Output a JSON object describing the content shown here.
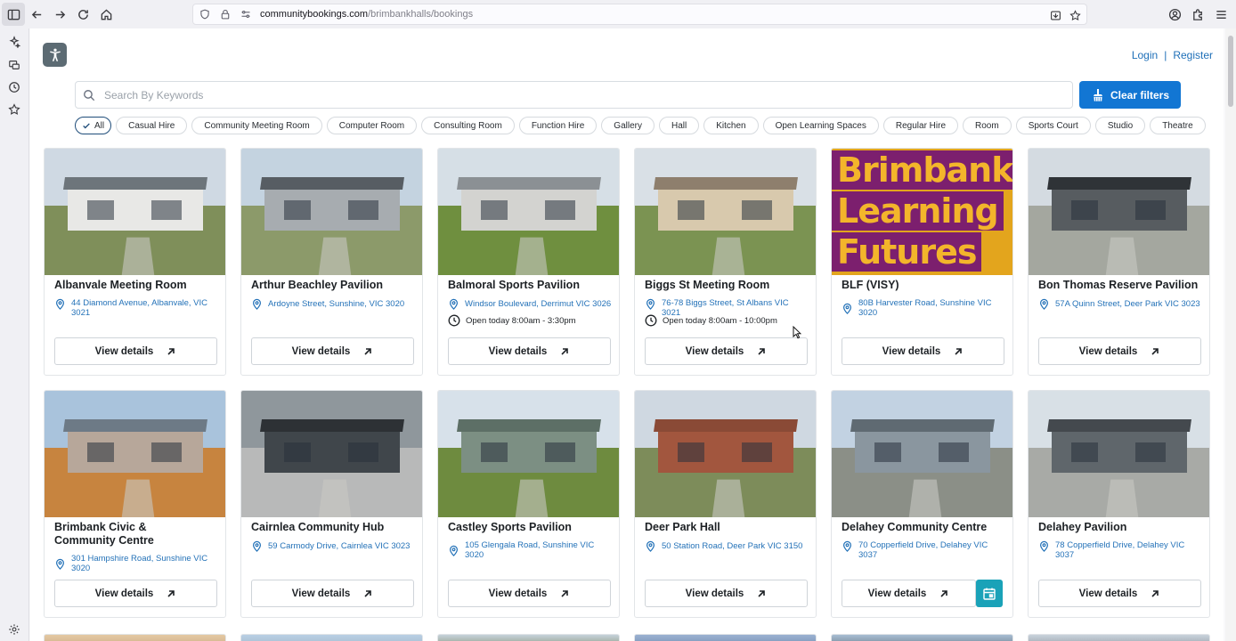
{
  "browser": {
    "url_host": "communitybookings.com",
    "url_path": "/brimbankhalls/bookings"
  },
  "header": {
    "login": "Login",
    "separator": "|",
    "register": "Register"
  },
  "search": {
    "placeholder": "Search By Keywords"
  },
  "clear_filters": "Clear filters",
  "filters": [
    "All",
    "Casual Hire",
    "Community Meeting Room",
    "Computer Room",
    "Consulting Room",
    "Function Hire",
    "Gallery",
    "Hall",
    "Kitchen",
    "Open Learning Spaces",
    "Regular Hire",
    "Room",
    "Sports Court",
    "Studio",
    "Theatre"
  ],
  "active_filter": "All",
  "view_details_label": "View details",
  "accent_color": "#1276d3",
  "calendar_color": "#1aa2b8",
  "venues": [
    {
      "name": "Albanvale Meeting Room",
      "address": "44 Diamond Avenue, Albanvale, VIC 3021",
      "hours": ""
    },
    {
      "name": "Arthur Beachley Pavilion",
      "address": "Ardoyne Street, Sunshine, VIC 3020",
      "hours": ""
    },
    {
      "name": "Balmoral Sports Pavilion",
      "address": "Windsor Boulevard, Derrimut VIC 3026",
      "hours": "Open today 8:00am - 3:30pm"
    },
    {
      "name": "Biggs St Meeting Room",
      "address": "76-78 Biggs Street, St Albans VIC 3021",
      "hours": "Open today 8:00am - 10:00pm"
    },
    {
      "name": "BLF (VISY)",
      "address": "80B Harvester Road, Sunshine VIC 3020",
      "hours": "",
      "image_text": [
        "Brimbank",
        "Learning",
        "Futures"
      ]
    },
    {
      "name": "Bon Thomas Reserve Pavilion",
      "address": "57A Quinn Street, Deer Park VIC 3023",
      "hours": ""
    },
    {
      "name": "Brimbank Civic & Community Centre",
      "address": "301 Hampshire Road, Sunshine VIC 3020",
      "hours": ""
    },
    {
      "name": "Cairnlea Community Hub",
      "address": "59 Carmody Drive, Cairnlea VIC 3023",
      "hours": ""
    },
    {
      "name": "Castley Sports Pavilion",
      "address": "105 Glengala Road, Sunshine VIC 3020",
      "hours": ""
    },
    {
      "name": "Deer Park Hall",
      "address": "50 Station Road, Deer Park VIC 3150",
      "hours": ""
    },
    {
      "name": "Delahey Community Centre",
      "address": "70 Copperfield Drive, Delahey VIC 3037",
      "hours": "",
      "calendar": true
    },
    {
      "name": "Delahey Pavilion",
      "address": "78 Copperfield Drive, Delahey VIC 3037",
      "hours": ""
    }
  ]
}
